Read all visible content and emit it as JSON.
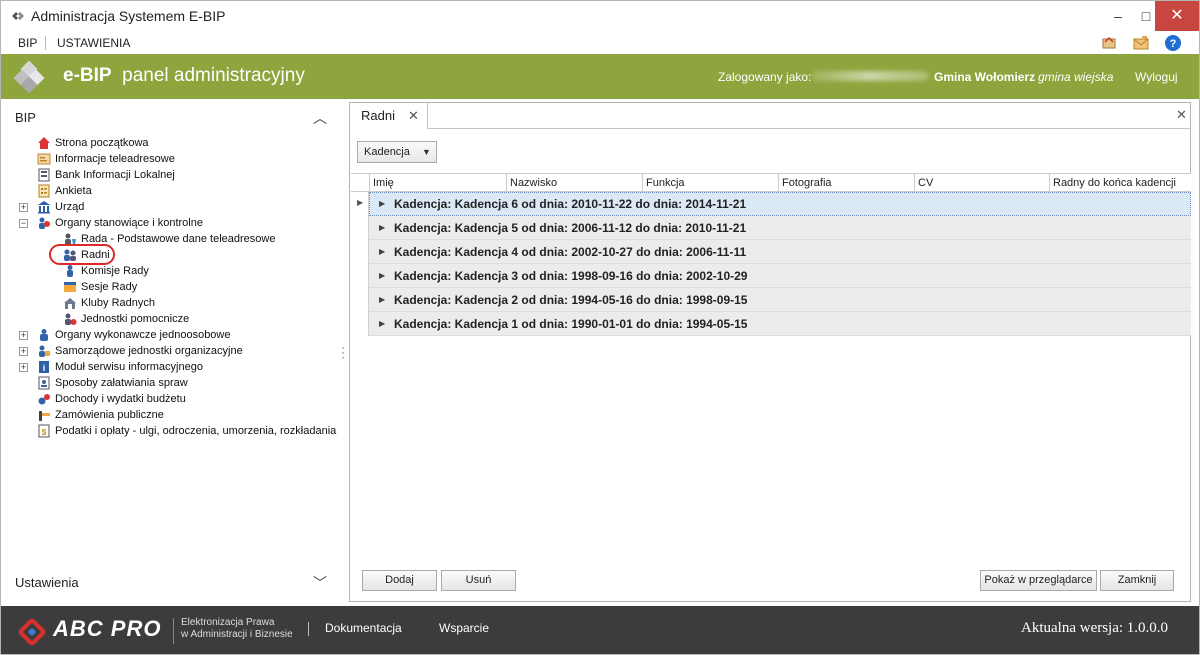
{
  "window": {
    "title": "Administracja Systemem E-BIP",
    "minimize_glyph": "–",
    "maximize_glyph": "□",
    "close_glyph": "✕"
  },
  "menu": {
    "items": [
      "BIP",
      "USTAWIENIA"
    ]
  },
  "header": {
    "brand_bold": "e-BIP",
    "brand_rest": "panel administracyjny",
    "login_label": "Zalogowany jako:",
    "organization": "Gmina Wołomierz",
    "organization_type": "gmina wiejska",
    "logout": "Wyloguj",
    "color": "#8ea43d"
  },
  "sidebar": {
    "section_title": "BIP",
    "settings_title": "Ustawienia",
    "tree": [
      {
        "label": "Strona początkowa",
        "icon": "home-icon"
      },
      {
        "label": "Informacje teleadresowe",
        "icon": "contact-card-icon"
      },
      {
        "label": "Bank Informacji Lokalnej",
        "icon": "database-icon"
      },
      {
        "label": "Ankieta",
        "icon": "survey-icon"
      },
      {
        "label": "Urząd",
        "icon": "building-icon",
        "expander": "+"
      },
      {
        "label": "Organy stanowiące i kontrolne",
        "icon": "council-icon",
        "expander": "−"
      },
      {
        "label": "Rada - Podstawowe dane teleadresowe",
        "icon": "council-contact-icon"
      },
      {
        "label": "Radni",
        "icon": "councilors-icon"
      },
      {
        "label": "Komisje Rady",
        "icon": "committee-icon"
      },
      {
        "label": "Sesje Rady",
        "icon": "session-icon"
      },
      {
        "label": "Kluby Radnych",
        "icon": "club-icon"
      },
      {
        "label": "Jednostki pomocnicze",
        "icon": "auxiliary-unit-icon"
      },
      {
        "label": "Organy wykonawcze jednoosobowe",
        "icon": "executive-icon",
        "expander": "+"
      },
      {
        "label": "Samorządowe jednostki organizacyjne",
        "icon": "organization-icon",
        "expander": "+"
      },
      {
        "label": "Moduł serwisu informacyjnego",
        "icon": "info-icon",
        "expander": "+"
      },
      {
        "label": "Sposoby załatwiania spraw",
        "icon": "procedure-icon"
      },
      {
        "label": "Dochody i wydatki budżetu",
        "icon": "budget-icon"
      },
      {
        "label": "Zamówienia publiczne",
        "icon": "tender-icon"
      },
      {
        "label": "Podatki i opłaty - ulgi, odroczenia, umorzenia, rozkładania",
        "icon": "tax-icon"
      }
    ]
  },
  "panel": {
    "tab_label": "Radni",
    "tab_close": "✕",
    "panel_close": "✕",
    "group_by_chip": "Kadencja",
    "columns": [
      "Imię",
      "Nazwisko",
      "Funkcja",
      "Fotografia",
      "CV",
      "Radny do końca kadencji"
    ],
    "groups": [
      "Kadencja: Kadencja 6 od dnia: 2010-11-22 do dnia: 2014-11-21",
      "Kadencja: Kadencja 5 od dnia: 2006-11-12 do dnia: 2010-11-21",
      "Kadencja: Kadencja 4 od dnia: 2002-10-27 do dnia: 2006-11-11",
      "Kadencja: Kadencja 3 od dnia: 1998-09-16 do dnia: 2002-10-29",
      "Kadencja: Kadencja 2 od dnia: 1994-05-16 do dnia: 1998-09-15",
      "Kadencja: Kadencja 1 od dnia: 1990-01-01 do dnia: 1994-05-15"
    ],
    "buttons": {
      "add": "Dodaj",
      "delete": "Usuń",
      "preview": "Pokaż w przeglądarce",
      "close": "Zamknij"
    }
  },
  "footer": {
    "brand": "ABC PRO",
    "tagline_1": "Elektronizacja Prawa",
    "tagline_2": "w Administracji i Biznesie",
    "link_docs": "Dokumentacja",
    "link_support": "Wsparcie",
    "version": "Aktualna wersja: 1.0.0.0"
  }
}
